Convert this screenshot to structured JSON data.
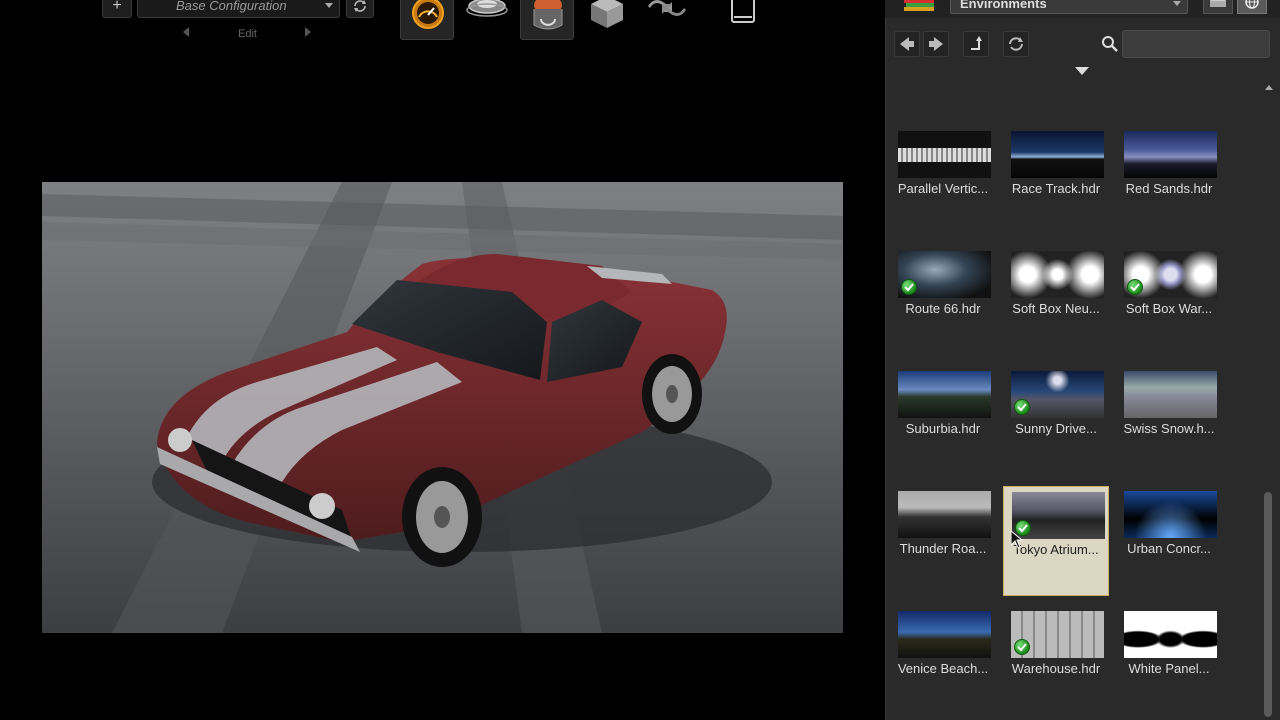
{
  "toolbar": {
    "add_label": "+",
    "configuration": "Base Configuration",
    "edit_label": "Edit",
    "tools": [
      "gauge-tool-icon",
      "turntable-icon",
      "render-tool-icon",
      "cube-icon",
      "reload-arrows-icon",
      "tablet-icon"
    ]
  },
  "panel": {
    "library_selector": "Environments",
    "search": {
      "value": "",
      "placeholder": ""
    },
    "items": [
      {
        "label": "Parallel Vertic...",
        "check": false
      },
      {
        "label": "Race Track.hdr",
        "check": false
      },
      {
        "label": "Red Sands.hdr",
        "check": false
      },
      {
        "label": "Route 66.hdr",
        "check": true
      },
      {
        "label": "Soft Box Neu...",
        "check": false
      },
      {
        "label": "Soft Box War...",
        "check": true
      },
      {
        "label": "Suburbia.hdr",
        "check": false
      },
      {
        "label": "Sunny Drive...",
        "check": true
      },
      {
        "label": "Swiss Snow.h...",
        "check": false
      },
      {
        "label": "Thunder Roa...",
        "check": false
      },
      {
        "label": "Tokyo Atrium...",
        "check": true,
        "selected": true
      },
      {
        "label": "Urban Concr...",
        "check": false
      },
      {
        "label": "Venice Beach...",
        "check": false
      },
      {
        "label": "Warehouse.hdr",
        "check": true
      },
      {
        "label": "White Panel...",
        "check": false
      }
    ]
  },
  "colors": {
    "background": "#000000",
    "panel": "#2a2a2a",
    "selection": "#dcd7c3",
    "car_body": "#7a2a2e",
    "check_green": "#2aa52a"
  }
}
